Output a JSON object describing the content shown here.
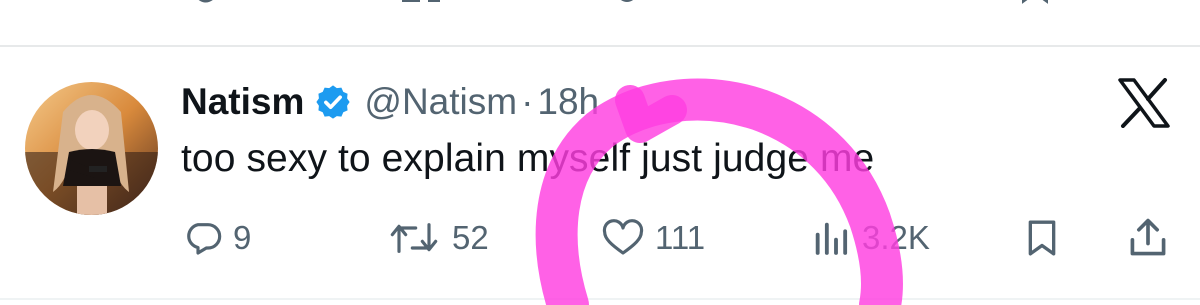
{
  "tweet": {
    "author_name": "Natism",
    "handle": "@Natism",
    "separator": "·",
    "timestamp": "18h",
    "text": "too sexy to explain myself just judge me",
    "platform_icon": "x-logo-icon"
  },
  "actions": {
    "replies": "9",
    "reposts": "52",
    "likes": "111",
    "views": "3.2K",
    "icons": [
      "reply-icon",
      "repost-icon",
      "like-icon",
      "views-icon",
      "bookmark-icon",
      "share-icon"
    ]
  },
  "colors": {
    "text_primary": "#0f1419",
    "text_secondary": "#536471",
    "verified_blue": "#1d9bf0",
    "annotation_pink": "#ff3ee0",
    "divider": "#e7e9ea"
  }
}
